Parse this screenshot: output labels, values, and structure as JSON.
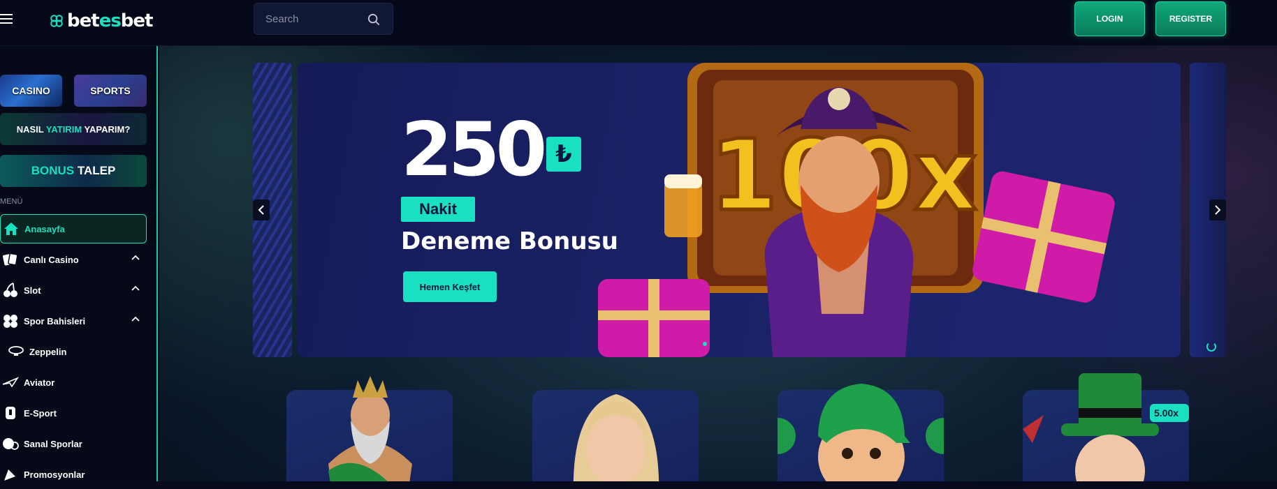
{
  "header": {
    "logo_left": "betes",
    "logo_accent": "",
    "logo_text": "betesbet",
    "search_placeholder": "Search",
    "login_label": "LOGIN",
    "register_label": "REGISTER"
  },
  "sidebar": {
    "tiles": [
      {
        "label": "CASINO"
      },
      {
        "label": "SPORTS"
      }
    ],
    "promo_yatirim": {
      "part1": "NASIL ",
      "highlight": "YATIRIM",
      "part2": " YAPARIM?"
    },
    "promo_bonus": {
      "highlight": "BONUS",
      "part2": " TALEP"
    },
    "menu_label": "MENÜ",
    "items": [
      {
        "label": "Anasayfa",
        "icon": "home-icon",
        "active": true
      },
      {
        "label": "Canlı Casino",
        "icon": "cards-icon",
        "expandable": true
      },
      {
        "label": "Slot",
        "icon": "cherry-icon",
        "expandable": true
      },
      {
        "label": "Spor Bahisleri",
        "icon": "sports-icon",
        "expandable": true
      },
      {
        "label": "Zeppelin",
        "icon": "zeppelin-icon"
      },
      {
        "label": "Aviator",
        "icon": "plane-icon"
      },
      {
        "label": "E-Sport",
        "icon": "gamepad-icon"
      },
      {
        "label": "Sanal Sporlar",
        "icon": "virtual-sports-icon"
      },
      {
        "label": "Promosyonlar",
        "icon": "promo-icon"
      }
    ]
  },
  "slider": {
    "amount": "250",
    "currency_symbol": "₺",
    "badge": "Nakit",
    "title": "Deneme Bonusu",
    "cta_label": "Hemen Keşfet",
    "art_multiplier": "100x"
  },
  "cards": {
    "multiplier_badge": "5.00x"
  },
  "colors": {
    "accent": "#19e0c0",
    "background": "#050818",
    "button_green": "#0fa87b"
  }
}
